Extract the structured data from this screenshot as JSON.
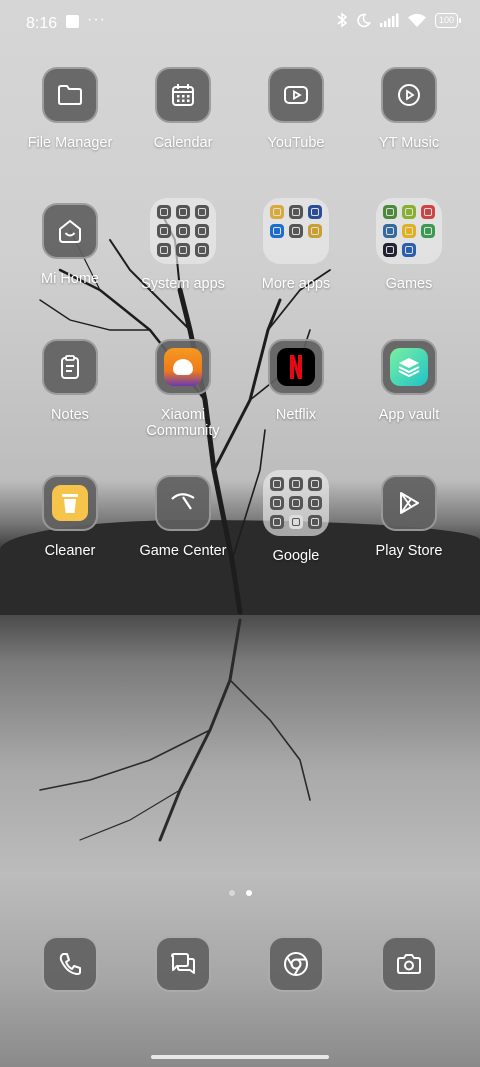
{
  "status_bar": {
    "time": "8:16",
    "battery": "100"
  },
  "apps": [
    {
      "label": "File Manager",
      "icon": "folder-icon"
    },
    {
      "label": "Calendar",
      "icon": "calendar-icon"
    },
    {
      "label": "YouTube",
      "icon": "play-rectangle-icon"
    },
    {
      "label": "YT Music",
      "icon": "play-circle-icon"
    },
    {
      "label": "Mi Home",
      "icon": "smart-home-icon"
    },
    {
      "label": "System apps",
      "icon": "folder"
    },
    {
      "label": "More apps",
      "icon": "folder"
    },
    {
      "label": "Games",
      "icon": "folder"
    },
    {
      "label": "Notes",
      "icon": "notes-icon"
    },
    {
      "label": "Xiaomi Community",
      "icon": "xiaomi-community-icon"
    },
    {
      "label": "Netflix",
      "icon": "netflix-icon"
    },
    {
      "label": "App vault",
      "icon": "app-vault-icon"
    },
    {
      "label": "Cleaner",
      "icon": "cleaner-icon"
    },
    {
      "label": "Game Center",
      "icon": "game-center-icon"
    },
    {
      "label": "Google",
      "icon": "folder"
    },
    {
      "label": "Play Store",
      "icon": "play-store-icon"
    }
  ],
  "page_indicator": {
    "pages": 2,
    "current": 2
  },
  "dock": [
    {
      "icon": "phone-icon"
    },
    {
      "icon": "messages-icon"
    },
    {
      "icon": "chrome-icon"
    },
    {
      "icon": "camera-icon"
    }
  ],
  "colors": {
    "netflix_red": "#e50914",
    "vault_green": "#3fd79a",
    "cleaner_yellow": "#f6c34b",
    "community_orange": "#f28a1b"
  }
}
